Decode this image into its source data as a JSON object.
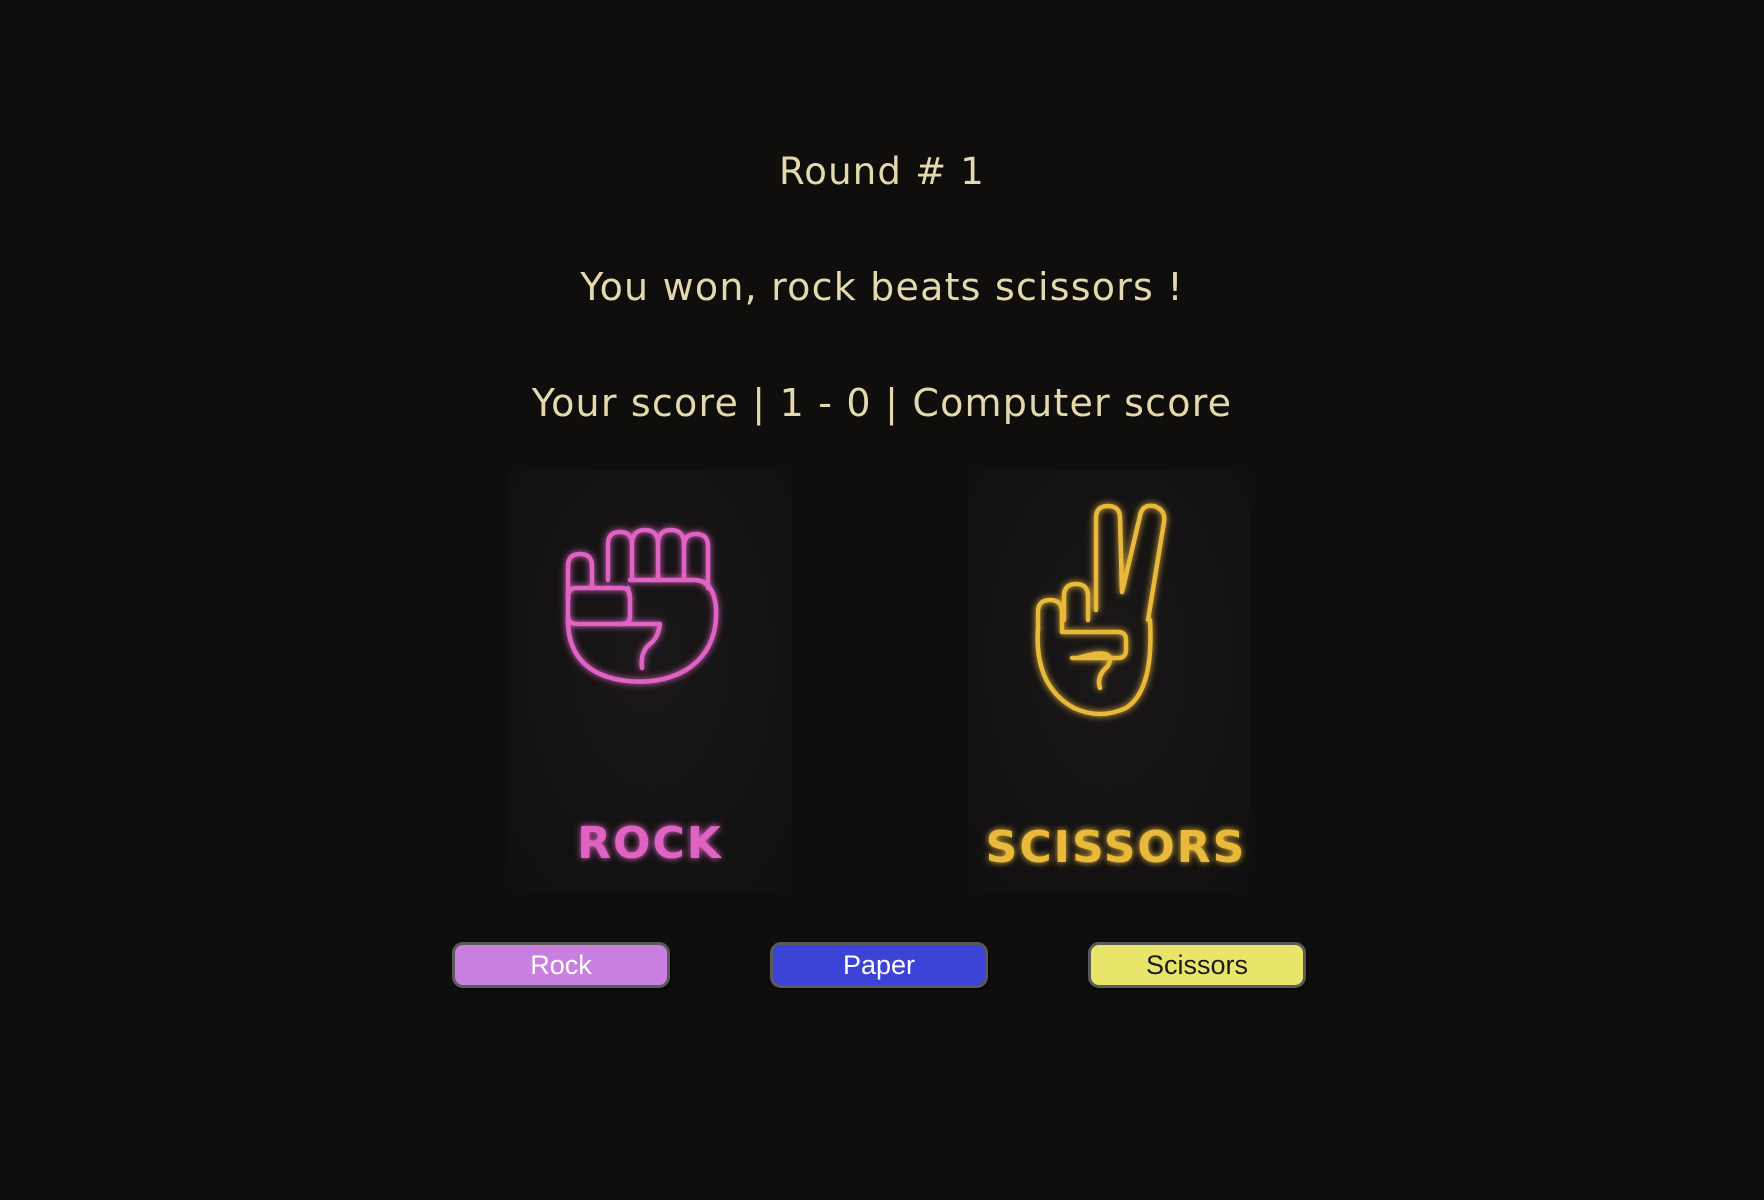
{
  "game": {
    "round_text": "Round # 1",
    "result_text": "You won, rock beats scissors !",
    "score_text": "Your score | 1 - 0 | Computer score"
  },
  "player_card": {
    "label": "ROCK",
    "icon": "fist-icon",
    "color": "#e064c4"
  },
  "computer_card": {
    "label": "SCISSORS",
    "icon": "peace-sign-icon",
    "color": "#e9b93a"
  },
  "buttons": {
    "rock": {
      "label": "Rock",
      "color": "#c97fe0"
    },
    "paper": {
      "label": "Paper",
      "color": "#3c44d8"
    },
    "scissors": {
      "label": "Scissors",
      "color": "#e8e56a"
    }
  }
}
